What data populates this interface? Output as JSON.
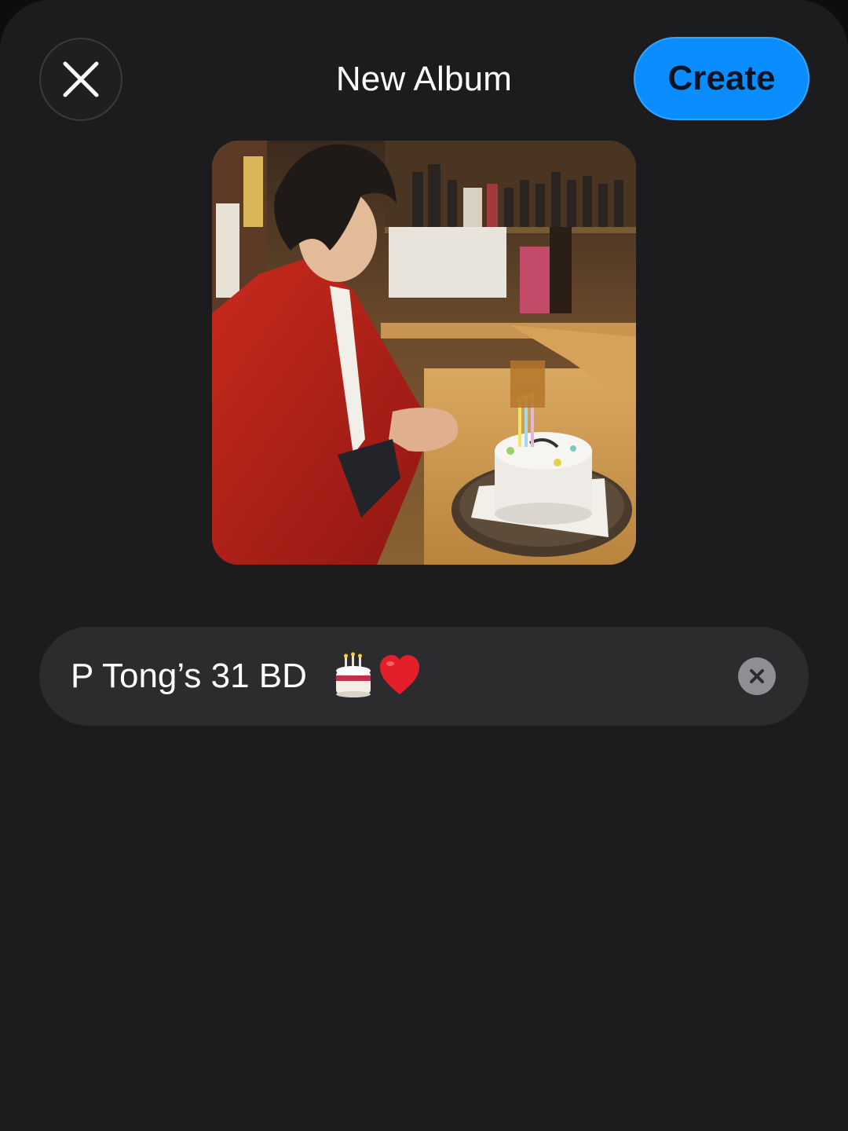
{
  "header": {
    "title": "New Album",
    "create_label": "Create",
    "close_icon": "close-icon"
  },
  "cover": {
    "description_icon": "album-cover-photo"
  },
  "name_field": {
    "text": "P Tong’s 31 BD",
    "emoji": [
      "birthday-cake-emoji",
      "red-heart-emoji"
    ],
    "clear_icon": "clear-text-icon"
  },
  "colors": {
    "background": "#1c1c1e",
    "field": "#2c2c2e",
    "accent": "#0a8dff"
  }
}
